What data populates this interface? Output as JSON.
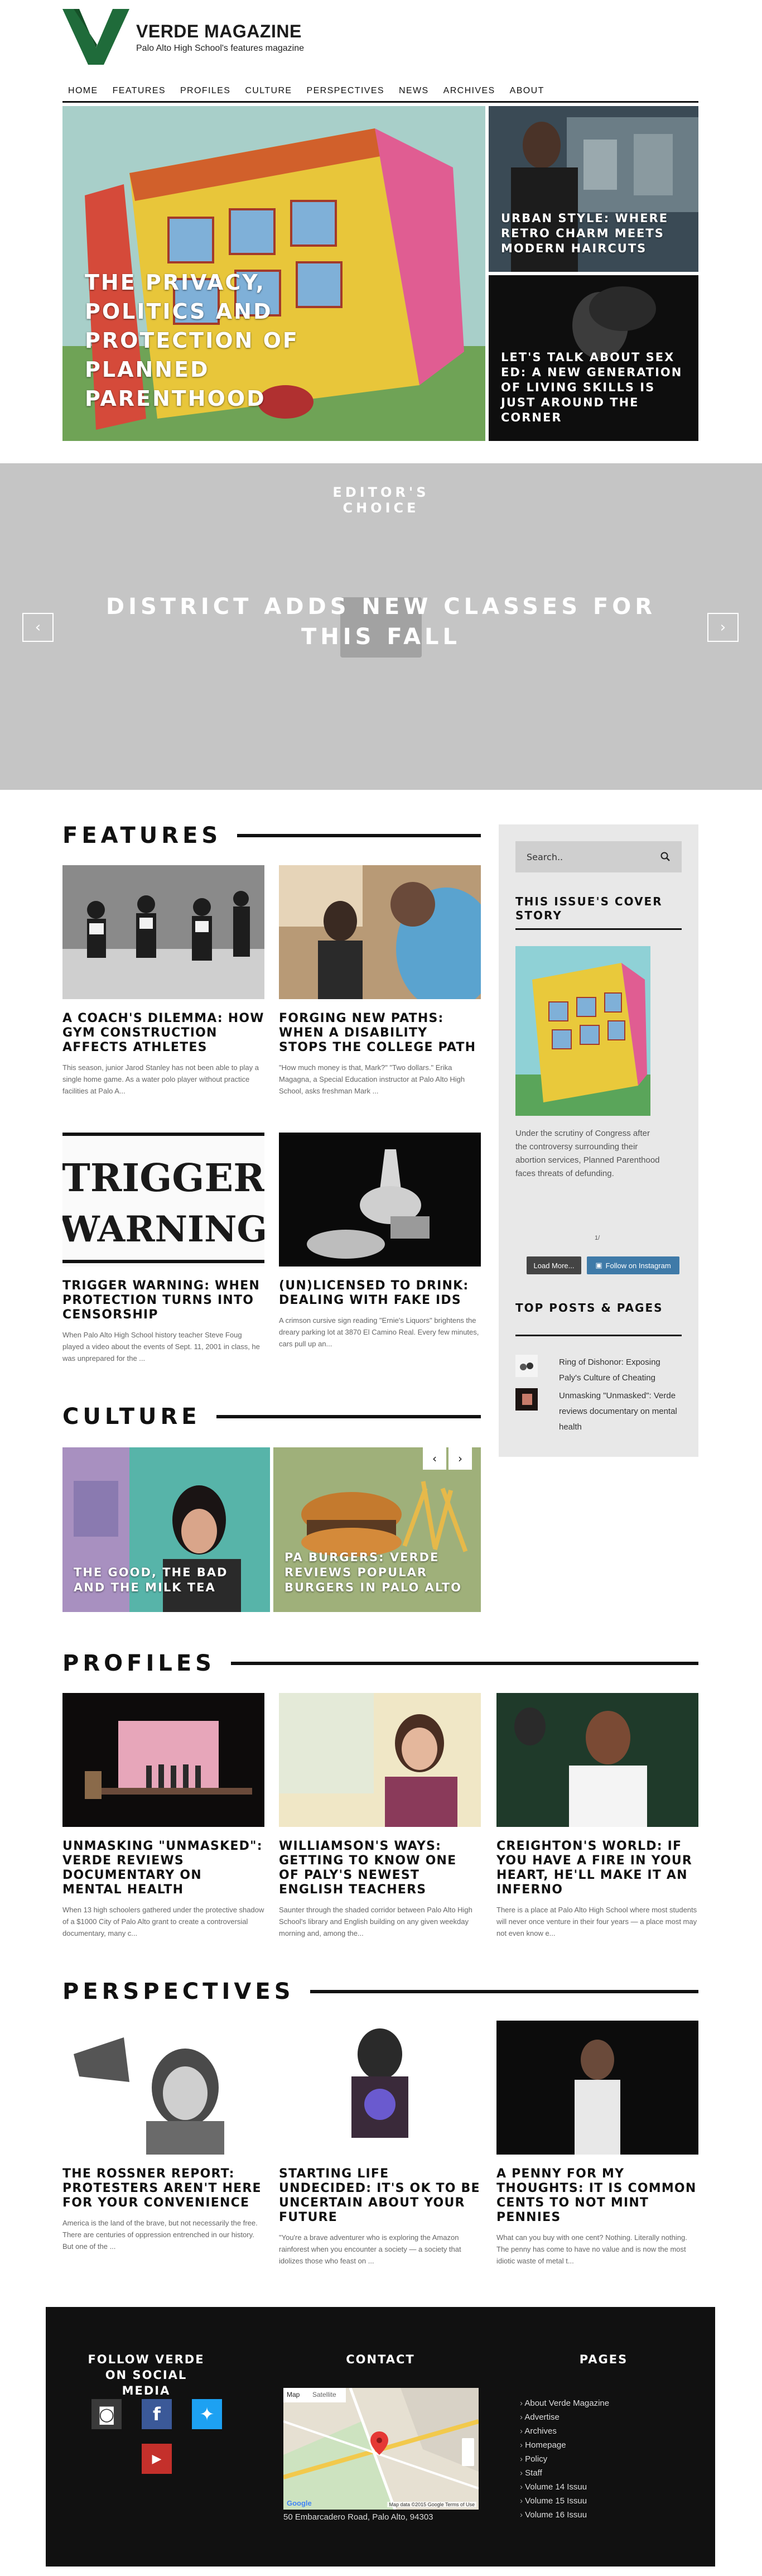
{
  "brand": {
    "name": "VERDE MAGAZINE",
    "tagline": "Palo Alto High School's features magazine",
    "logo_color": "#1f6b3a"
  },
  "nav": [
    "HOME",
    "FEATURES",
    "PROFILES",
    "CULTURE",
    "PERSPECTIVES",
    "NEWS",
    "ARCHIVES",
    "ABOUT"
  ],
  "hero": {
    "main_title": "THE PRIVACY, POLITICS AND PROTECTION OF PLANNED PARENTHOOD",
    "side_top_title": "URBAN STYLE: WHERE RETRO CHARM MEETS MODERN HAIRCUTS",
    "side_bottom_title": "LET'S TALK ABOUT SEX ED: A NEW GENERATION OF LIVING SKILLS IS JUST AROUND THE CORNER"
  },
  "editors_choice": {
    "label": "EDITOR'S CHOICE",
    "title": "DISTRICT ADDS NEW CLASSES FOR THIS FALL",
    "prev_icon": "chevron-left-icon",
    "next_icon": "chevron-right-icon"
  },
  "sections": {
    "features": "FEATURES",
    "culture": "CULTURE",
    "profiles": "PROFILES",
    "perspectives": "PERSPECTIVES"
  },
  "features": [
    {
      "title": "A COACH'S DILEMMA: HOW GYM CONSTRUCTION AFFECTS ATHLETES",
      "excerpt": "This season, junior Jarod Stanley has not been able to play a single home game. As a water polo player without practice facilities at Palo A..."
    },
    {
      "title": "FORGING NEW PATHS: WHEN A DISABILITY STOPS THE COLLEGE PATH",
      "excerpt": "\"How much money is that, Mark?\" \"Two dollars.\" Erika Magagna, a Special Education instructor at Palo Alto High School, asks freshman Mark ..."
    },
    {
      "title": "TRIGGER WARNING: WHEN PROTECTION TURNS INTO CENSORSHIP",
      "excerpt": "When Palo Alto High School history teacher Steve Foug played a video about the events of Sept. 11, 2001 in class, he was unprepared for the ..."
    },
    {
      "title": "(UN)LICENSED TO DRINK: DEALING WITH FAKE IDS",
      "excerpt": "A crimson cursive sign reading \"Ernie's Liquors\" brightens the dreary parking lot at 3870 El Camino Real. Every few minutes, cars pull up an..."
    }
  ],
  "trigger_art": {
    "line1": "TRIGGER",
    "line2": "WARNING"
  },
  "sidebar": {
    "search_placeholder": "Search..",
    "search_icon": "search-icon",
    "cover_heading": "THIS ISSUE'S COVER STORY",
    "cover_text": "Under the scrutiny of Congress after the controversy surrounding their abortion services, Planned Parenthood faces threats of defunding.",
    "pagination": "1/",
    "load_more": "Load More...",
    "follow_instagram": "Follow on Instagram",
    "top_heading": "TOP POSTS & PAGES",
    "top_posts": [
      "Ring of Dishonor: Exposing Paly's Culture of Cheating",
      "Unmasking \"Unmasked\": Verde reviews documentary on mental health"
    ]
  },
  "culture": [
    {
      "title": "THE GOOD, THE BAD AND THE MILK TEA"
    },
    {
      "title": "PA BURGERS: VERDE REVIEWS POPULAR BURGERS IN PALO ALTO"
    }
  ],
  "profiles": [
    {
      "title": "UNMASKING \"UNMASKED\": VERDE REVIEWS DOCUMENTARY ON MENTAL HEALTH",
      "excerpt": "When 13 high schoolers gathered under the protective shadow of a $1000 City of Palo Alto grant to create a controversial documentary, many c..."
    },
    {
      "title": "WILLIAMSON'S WAYS: GETTING TO KNOW ONE OF PALY'S NEWEST ENGLISH TEACHERS",
      "excerpt": "Saunter through the shaded corridor between Palo Alto High School's library and English building on any given weekday morning and, among the..."
    },
    {
      "title": "CREIGHTON'S WORLD: IF YOU HAVE A FIRE IN YOUR HEART, HE'LL MAKE IT AN INFERNO",
      "excerpt": "There is a place at Palo Alto High School where most students will never once venture in their four years — a place most may not even know e..."
    }
  ],
  "perspectives": [
    {
      "title": "THE ROSSNER REPORT: PROTESTERS AREN'T HERE FOR YOUR CONVENIENCE",
      "excerpt": "America is the land of the brave, but not necessarily the free. There are centuries of oppression entrenched in our history. But one of the ..."
    },
    {
      "title": "STARTING LIFE UNDECIDED: IT'S OK TO BE UNCERTAIN ABOUT YOUR FUTURE",
      "excerpt": "\"You're a brave adventurer who is exploring the Amazon rainforest when you encounter a society — a society that idolizes those who feast on ..."
    },
    {
      "title": "A PENNY FOR MY THOUGHTS: IT IS COMMON CENTS TO NOT MINT PENNIES",
      "excerpt": "What can you buy with one cent? Nothing. Literally nothing. The penny has come to have no value and is now the most idiotic waste of metal t..."
    }
  ],
  "footer": {
    "social_heading": "FOLLOW VERDE ON SOCIAL MEDIA",
    "contact_heading": "CONTACT",
    "pages_heading": "PAGES",
    "social_icons": [
      "instagram-icon",
      "facebook-icon",
      "twitter-icon",
      "youtube-icon"
    ],
    "social_colors": {
      "instagram": "#3a3a3a",
      "facebook": "#3b5998",
      "twitter": "#1da1f2",
      "youtube": "#c4302b"
    },
    "map_tabs": [
      "Map",
      "Satellite"
    ],
    "map_footer": "Map data ©2015 Google  Terms of Use",
    "google": "Google",
    "address": "50 Embarcadero Road, Palo Alto, 94303",
    "pages": [
      "About Verde Magazine",
      "Advertise",
      "Archives",
      "Homepage",
      "Policy",
      "Staff",
      "Volume 14 Issuu",
      "Volume 15 Issuu",
      "Volume 16 Issuu"
    ]
  }
}
